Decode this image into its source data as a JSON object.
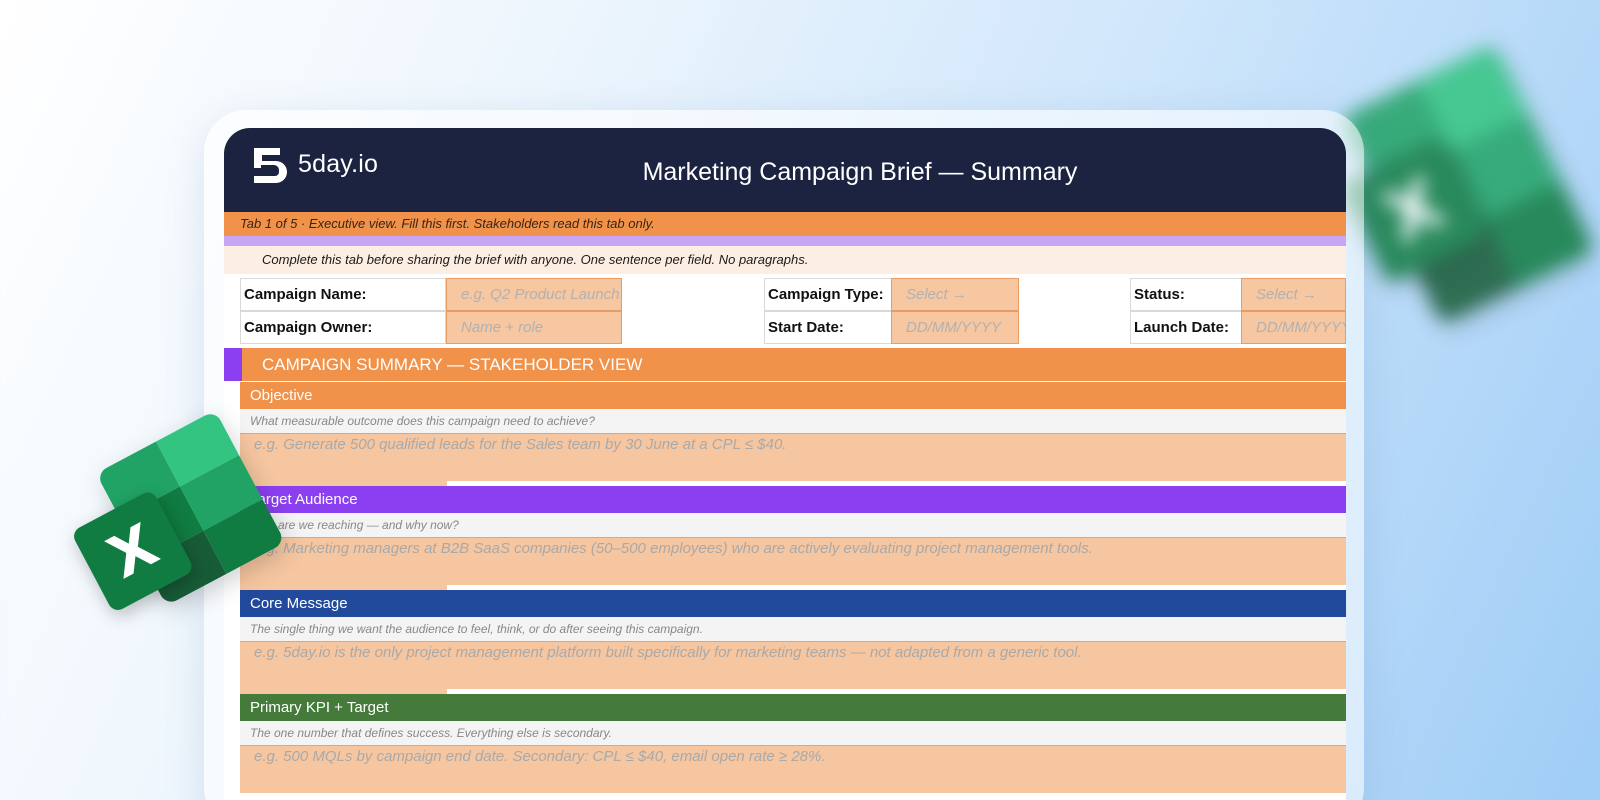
{
  "brand": {
    "name": "5day.io",
    "mark_text": "5DAY"
  },
  "header": {
    "title": "Marketing Campaign Brief — Summary"
  },
  "tab_strip": {
    "text": "Tab 1 of 5  ·  Executive view. Fill this first. Stakeholders read this tab only."
  },
  "note": {
    "text": "Complete this tab before sharing the brief with anyone. One sentence per field. No paragraphs."
  },
  "meta": {
    "campaign_name": {
      "label": "Campaign Name:",
      "placeholder": "e.g. Q2 Product Launch"
    },
    "campaign_owner": {
      "label": "Campaign Owner:",
      "placeholder": "Name + role"
    },
    "campaign_type": {
      "label": "Campaign Type:",
      "placeholder": "Select →"
    },
    "start_date": {
      "label": "Start Date:",
      "placeholder": "DD/MM/YYYY"
    },
    "status": {
      "label": "Status:",
      "placeholder": "Select →"
    },
    "launch_date": {
      "label": "Launch Date:",
      "placeholder": "DD/MM/YYYY"
    }
  },
  "section": {
    "title": "CAMPAIGN SUMMARY — STAKEHOLDER VIEW"
  },
  "blocks": [
    {
      "title": "Objective",
      "color": "#f0924a",
      "hint": "What measurable outcome does this campaign need to achieve?",
      "placeholder": "e.g. Generate 500 qualified leads for the Sales team by 30 June at a CPL ≤ $40."
    },
    {
      "title": "Target Audience",
      "color": "#8c3ff0",
      "hint": "Who are we reaching — and why now?",
      "placeholder": "e.g. Marketing managers at B2B SaaS companies (50–500 employees) who are actively evaluating project management tools."
    },
    {
      "title": "Core Message",
      "color": "#224a9c",
      "hint": "The single thing we want the audience to feel, think, or do after seeing this campaign.",
      "placeholder": "e.g. 5day.io is the only project management platform built specifically for marketing teams — not adapted from a generic tool."
    },
    {
      "title": "Primary KPI + Target",
      "color": "#447a3a",
      "hint": "The one number that defines success. Everything else is secondary.",
      "placeholder": "e.g. 500 MQLs by campaign end date. Secondary: CPL ≤ $40, email open rate ≥ 28%."
    }
  ],
  "colors": {
    "header_bg": "#1b2340",
    "accent_orange": "#f0924a",
    "accent_purple": "#8c3ff0",
    "input_fill": "#f6c6a0"
  },
  "icons": {
    "excel": "excel-logo-icon",
    "brand": "5day-logo-icon"
  },
  "excel_badge": "X"
}
